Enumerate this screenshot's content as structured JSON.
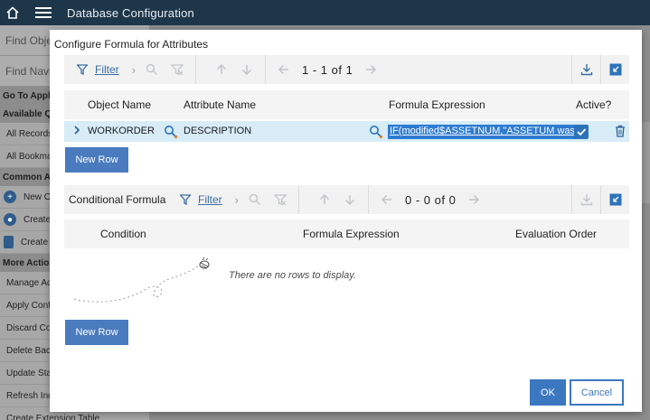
{
  "app": {
    "title": "Database Configuration"
  },
  "sidebar": {
    "find_object": "Find Objec",
    "find_navigation": "Find Navig",
    "go_to_apps": "Go To Applic",
    "available_queries": "Available Qu",
    "all_records": "All Records",
    "all_bookmarks": "All Bookmar",
    "common_actions": "Common Acti",
    "new_object": "New O",
    "create_1": "Create",
    "create_2": "Create",
    "more_actions": "More Actions",
    "manage_admin": "Manage Adn",
    "apply_config": "Apply Config",
    "discard_config": "Discard Con",
    "delete_backup": "Delete Back",
    "update_stats": "Update Stat",
    "refresh_indexes": "Refresh Ind",
    "create_extension": "Create Extension Table"
  },
  "dialog": {
    "title": "Configure Formula for Attributes",
    "attributes_table": {
      "filter_label": "Filter",
      "range": "1 - 1 of 1",
      "columns": {
        "object_name": "Object Name",
        "attribute_name": "Attribute Name",
        "formula_expression": "Formula Expression",
        "active": "Active?"
      },
      "rows": [
        {
          "object_name": "WORKORDER",
          "attribute_name": "DESCRIPTION",
          "formula_expression": "IF(modified$ASSETNUM,\"ASSETUM was",
          "active": true
        }
      ],
      "new_row_label": "New Row"
    },
    "conditional_table": {
      "label": "Conditional Formula",
      "filter_label": "Filter",
      "range": "0 - 0 of 0",
      "columns": {
        "condition": "Condition",
        "formula_expression": "Formula Expression",
        "evaluation_order": "Evaluation Order"
      },
      "empty_message": "There are no rows to display.",
      "new_row_label": "New Row"
    },
    "ok_label": "OK",
    "cancel_label": "Cancel"
  },
  "colors": {
    "topbar": "#1d3649",
    "accent": "#3b78c0",
    "row_highlight": "#d7ecf6"
  }
}
